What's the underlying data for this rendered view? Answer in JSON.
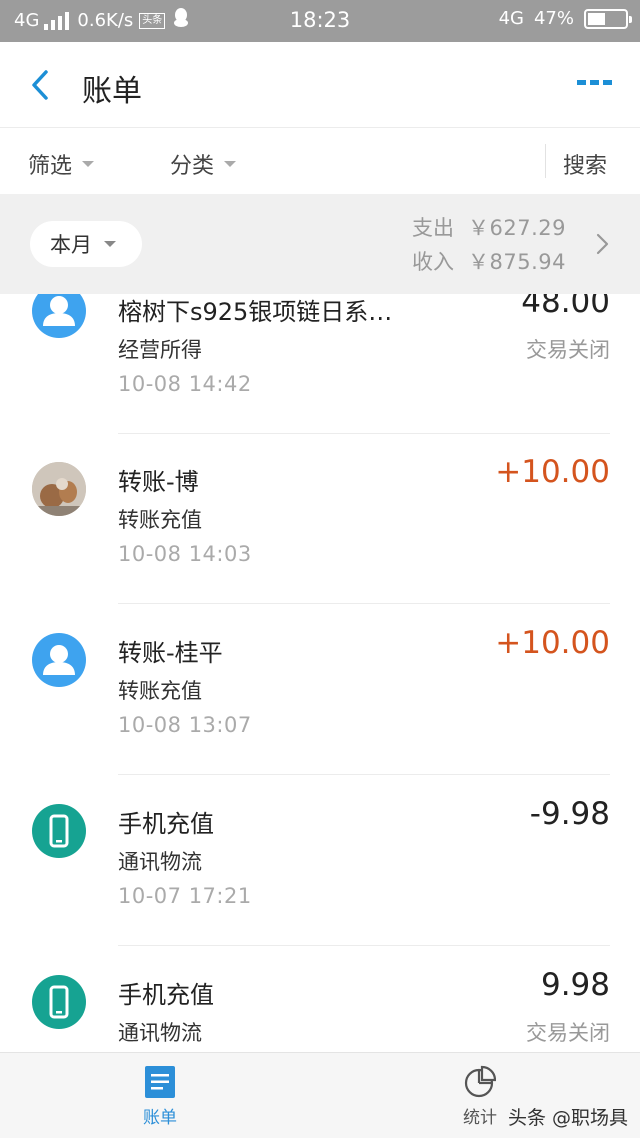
{
  "status_bar": {
    "network": "4G",
    "speed": "0.6K/s",
    "toutiao_badge": "头条",
    "time": "18:23",
    "network_right": "4G",
    "battery": "47%",
    "battery_level": 0.47
  },
  "header": {
    "title": "账单",
    "back_icon": "chevron-left-icon",
    "more_icon": "more-dots-icon",
    "accent": "#1c8fd6"
  },
  "filters": {
    "filter_label": "筛选",
    "category_label": "分类",
    "search_label": "搜索"
  },
  "summary": {
    "month_label": "本月",
    "expense_label": "支出",
    "expense_value": "￥627.29",
    "income_label": "收入",
    "income_value": "￥875.94"
  },
  "transactions": [
    {
      "name": "榕树下s925银项链日系…",
      "category": "经营所得",
      "datetime": "10-08  14:42",
      "amount": "48.00",
      "status": "交易关闭",
      "icon": "person-icon"
    },
    {
      "name": "转账-博",
      "category": "转账充值",
      "datetime": "10-08  14:03",
      "amount": "+10.00",
      "status": "",
      "icon": "photo-avatar"
    },
    {
      "name": "转账-桂平",
      "category": "转账充值",
      "datetime": "10-08  13:07",
      "amount": "+10.00",
      "status": "",
      "icon": "person-icon"
    },
    {
      "name": "手机充值",
      "category": "通讯物流",
      "datetime": "10-07  17:21",
      "amount": "-9.98",
      "status": "",
      "icon": "phone-icon"
    },
    {
      "name": "手机充值",
      "category": "通讯物流",
      "datetime": "",
      "amount": "9.98",
      "status": "交易关闭",
      "icon": "phone-icon"
    }
  ],
  "colors": {
    "positive_amount": "#d4541e",
    "avatar_blue": "#3ea3ef",
    "avatar_teal": "#16a392"
  },
  "tabbar": {
    "bill_label": "账单",
    "stats_label": "统计",
    "watermark": "头条 @职场具"
  }
}
